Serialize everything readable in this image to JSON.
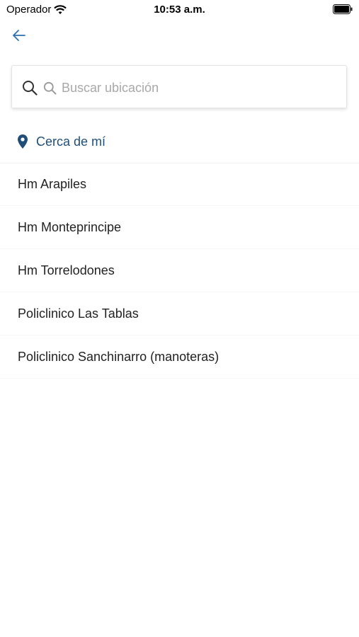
{
  "status_bar": {
    "carrier": "Operador",
    "time": "10:53 a.m."
  },
  "search": {
    "placeholder": "Buscar ubicación",
    "value": ""
  },
  "near_me": {
    "label": "Cerca de mí"
  },
  "locations": [
    {
      "label": "Hm Arapiles"
    },
    {
      "label": "Hm Monteprincipe"
    },
    {
      "label": "Hm Torrelodones"
    },
    {
      "label": "Policlinico Las Tablas"
    },
    {
      "label": "Policlinico Sanchinarro (manoteras)"
    }
  ],
  "colors": {
    "accent": "#1f4e79",
    "back_arrow": "#2f6fb0",
    "placeholder": "#a8a8a8"
  },
  "icons": {
    "back": "arrow-left-icon",
    "search": "magnifier-icon",
    "near_me": "map-pin-icon",
    "wifi": "wifi-icon",
    "battery": "battery-icon"
  }
}
